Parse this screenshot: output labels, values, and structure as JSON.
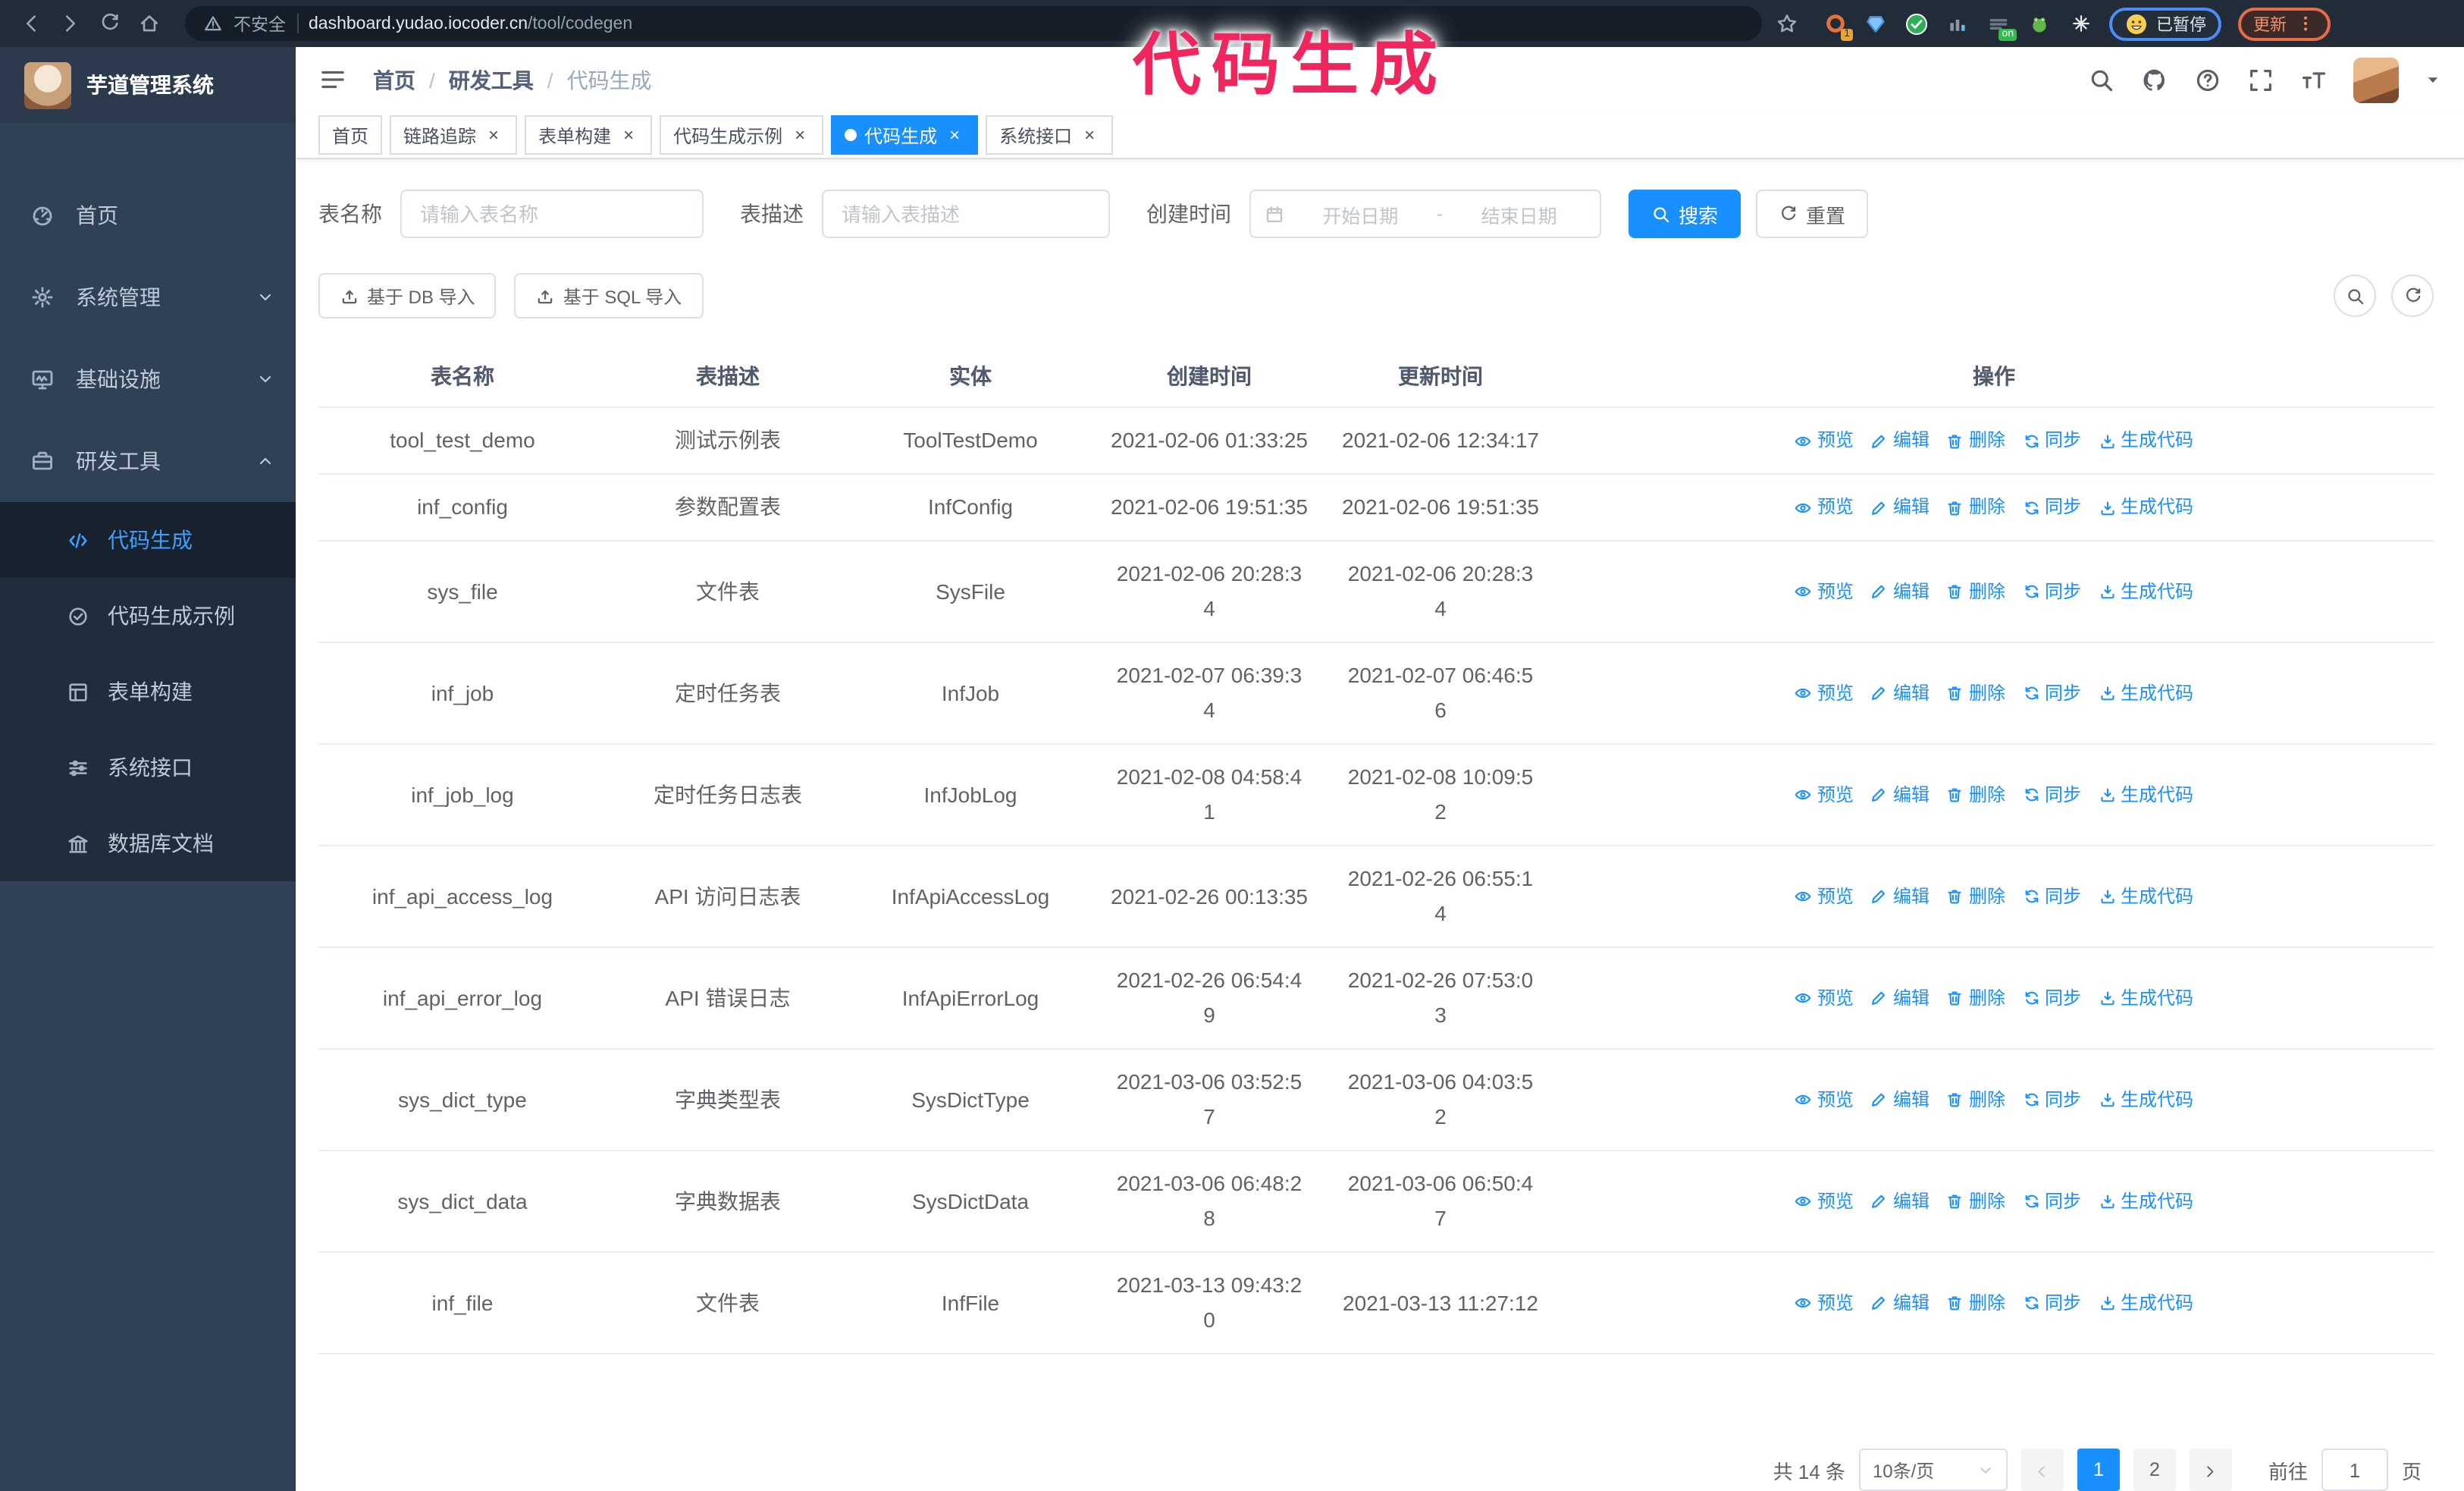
{
  "browser": {
    "security_label": "不安全",
    "url_domain": "dashboard.yudao.iocoder.cn",
    "url_path": "/tool/codegen",
    "extension_badge": "1",
    "extension_on_badge": "on",
    "profile_status": "已暂停",
    "update_label": "更新"
  },
  "annotation": {
    "text": "代码生成",
    "color": "#f0265f"
  },
  "sidebar": {
    "logo_title": "芋道管理系统",
    "items": [
      {
        "label": "首页",
        "icon": "dashboard-icon",
        "arrow": null
      },
      {
        "label": "系统管理",
        "icon": "gear-icon",
        "arrow": "down"
      },
      {
        "label": "基础设施",
        "icon": "monitor-icon",
        "arrow": "down"
      },
      {
        "label": "研发工具",
        "icon": "toolbox-icon",
        "arrow": "up"
      }
    ],
    "submenu": [
      {
        "label": "代码生成",
        "icon": "code-icon",
        "active": true
      },
      {
        "label": "代码生成示例",
        "icon": "check-circle-icon",
        "active": false
      },
      {
        "label": "表单构建",
        "icon": "form-icon",
        "active": false
      },
      {
        "label": "系统接口",
        "icon": "sliders-icon",
        "active": false
      },
      {
        "label": "数据库文档",
        "icon": "columns-icon",
        "active": false
      }
    ]
  },
  "header": {
    "breadcrumb": [
      "首页",
      "研发工具",
      "代码生成"
    ],
    "separator": "/"
  },
  "tabs": [
    {
      "label": "首页",
      "closable": false,
      "active": false
    },
    {
      "label": "链路追踪",
      "closable": true,
      "active": false
    },
    {
      "label": "表单构建",
      "closable": true,
      "active": false
    },
    {
      "label": "代码生成示例",
      "closable": true,
      "active": false
    },
    {
      "label": "代码生成",
      "closable": true,
      "active": true
    },
    {
      "label": "系统接口",
      "closable": true,
      "active": false
    }
  ],
  "filters": {
    "table_name_label": "表名称",
    "table_name_placeholder": "请输入表名称",
    "table_desc_label": "表描述",
    "table_desc_placeholder": "请输入表描述",
    "create_time_label": "创建时间",
    "date_start_placeholder": "开始日期",
    "date_separator": "-",
    "date_end_placeholder": "结束日期",
    "search_label": "搜索",
    "reset_label": "重置"
  },
  "toolbar": {
    "import_db_label": "基于 DB 导入",
    "import_sql_label": "基于 SQL 导入"
  },
  "table": {
    "columns": [
      "表名称",
      "表描述",
      "实体",
      "创建时间",
      "更新时间",
      "操作"
    ],
    "actions": [
      "预览",
      "编辑",
      "删除",
      "同步",
      "生成代码"
    ],
    "action_icons": [
      "eye-icon",
      "edit-icon",
      "trash-icon",
      "sync-icon",
      "download-icon"
    ],
    "rows": [
      {
        "name": "tool_test_demo",
        "desc": "测试示例表",
        "entity": "ToolTestDemo",
        "created": "2021-02-06 01:33:25",
        "updated": "2021-02-06 12:34:17"
      },
      {
        "name": "inf_config",
        "desc": "参数配置表",
        "entity": "InfConfig",
        "created": "2021-02-06 19:51:35",
        "updated": "2021-02-06 19:51:35"
      },
      {
        "name": "sys_file",
        "desc": "文件表",
        "entity": "SysFile",
        "created": "2021-02-06 20:28:3\n4",
        "updated": "2021-02-06 20:28:3\n4"
      },
      {
        "name": "inf_job",
        "desc": "定时任务表",
        "entity": "InfJob",
        "created": "2021-02-07 06:39:3\n4",
        "updated": "2021-02-07 06:46:5\n6"
      },
      {
        "name": "inf_job_log",
        "desc": "定时任务日志表",
        "entity": "InfJobLog",
        "created": "2021-02-08 04:58:4\n1",
        "updated": "2021-02-08 10:09:5\n2"
      },
      {
        "name": "inf_api_access_log",
        "desc": "API 访问日志表",
        "entity": "InfApiAccessLog",
        "created": "2021-02-26 00:13:35",
        "updated": "2021-02-26 06:55:1\n4"
      },
      {
        "name": "inf_api_error_log",
        "desc": "API 错误日志",
        "entity": "InfApiErrorLog",
        "created": "2021-02-26 06:54:4\n9",
        "updated": "2021-02-26 07:53:0\n3"
      },
      {
        "name": "sys_dict_type",
        "desc": "字典类型表",
        "entity": "SysDictType",
        "created": "2021-03-06 03:52:5\n7",
        "updated": "2021-03-06 04:03:5\n2"
      },
      {
        "name": "sys_dict_data",
        "desc": "字典数据表",
        "entity": "SysDictData",
        "created": "2021-03-06 06:48:2\n8",
        "updated": "2021-03-06 06:50:4\n7"
      },
      {
        "name": "inf_file",
        "desc": "文件表",
        "entity": "InfFile",
        "created": "2021-03-13 09:43:2\n0",
        "updated": "2021-03-13 11:27:12"
      }
    ]
  },
  "pagination": {
    "total_label": "共 14 条",
    "page_size": "10条/页",
    "pages": [
      "1",
      "2"
    ],
    "active_page": "1",
    "goto_label": "前往",
    "goto_value": "1",
    "page_label": "页"
  },
  "colors": {
    "accent": "#1890ff",
    "sidebar_bg": "#304156",
    "submenu_bg": "#1f2d3d",
    "menu_active_text": "#409eff",
    "annotation": "#f0265f",
    "chrome_bg": "#222c38"
  }
}
